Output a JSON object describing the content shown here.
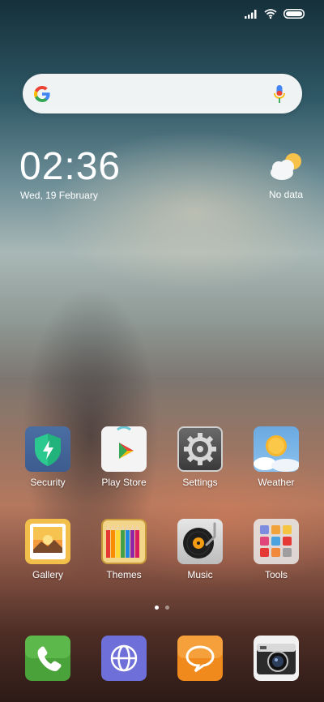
{
  "status_bar": {
    "icons": [
      "signal-icon",
      "wifi-icon",
      "battery-icon"
    ]
  },
  "search": {
    "icon": "google-logo-icon",
    "mic_icon": "mic-icon"
  },
  "clock": {
    "time": "02:36",
    "date": "Wed, 19 February"
  },
  "weather": {
    "icon": "cloud-sun-icon",
    "status": "No data"
  },
  "apps_row1": [
    {
      "label": "Security",
      "icon": "security-shield-icon"
    },
    {
      "label": "Play Store",
      "icon": "play-store-icon"
    },
    {
      "label": "Settings",
      "icon": "settings-gear-icon"
    },
    {
      "label": "Weather",
      "icon": "weather-sun-icon"
    }
  ],
  "apps_row2": [
    {
      "label": "Gallery",
      "icon": "gallery-icon"
    },
    {
      "label": "Themes",
      "icon": "themes-pencils-icon"
    },
    {
      "label": "Music",
      "icon": "music-turntable-icon"
    },
    {
      "label": "Tools",
      "icon": "tools-folder-icon"
    }
  ],
  "pager": {
    "pages": 2,
    "active": 1
  },
  "dock": [
    {
      "icon": "phone-icon"
    },
    {
      "icon": "browser-globe-icon"
    },
    {
      "icon": "messaging-icon"
    },
    {
      "icon": "camera-icon"
    }
  ]
}
